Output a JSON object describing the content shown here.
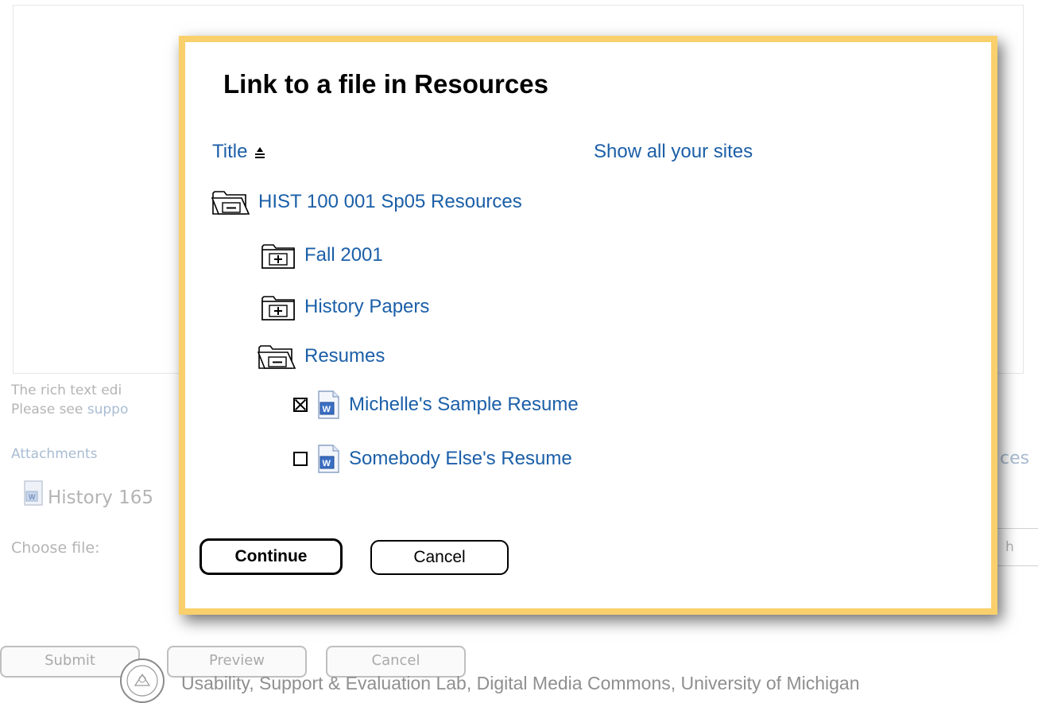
{
  "background": {
    "editor_note_line1": "The rich text edi",
    "editor_note_line2_prefix": "Please see ",
    "editor_note_line2_link": "suppo",
    "attachments_label": "Attachments",
    "attachment_name": "History 165",
    "choose_file_label": "Choose file:",
    "right_edge_link": "ces",
    "right_edge_input_text": "h",
    "buttons": {
      "submit": "Submit",
      "preview": "Preview",
      "cancel": "Cancel"
    }
  },
  "dialog": {
    "title": "Link to a file in Resources",
    "column_title": "Title",
    "show_all_sites": "Show all your sites",
    "tree": {
      "root": {
        "label": "HIST 100 001 Sp05 Resources",
        "state": "expanded"
      },
      "folders": [
        {
          "label": "Fall 2001",
          "state": "collapsed"
        },
        {
          "label": "History Papers",
          "state": "collapsed"
        },
        {
          "label": "Resumes",
          "state": "expanded"
        }
      ],
      "files": [
        {
          "label": "Michelle's Sample Resume",
          "checked": true,
          "icon": "word-doc-icon"
        },
        {
          "label": "Somebody Else's Resume",
          "checked": false,
          "icon": "word-doc-icon"
        }
      ]
    },
    "buttons": {
      "continue": "Continue",
      "cancel": "Cancel"
    }
  },
  "footer_credit": "Usability, Support & Evaluation Lab, Digital Media Commons, University of Michigan",
  "colors": {
    "dialog_border": "#f9d06c",
    "link": "#1b5fa8",
    "faded_text": "#b4b4b4"
  }
}
